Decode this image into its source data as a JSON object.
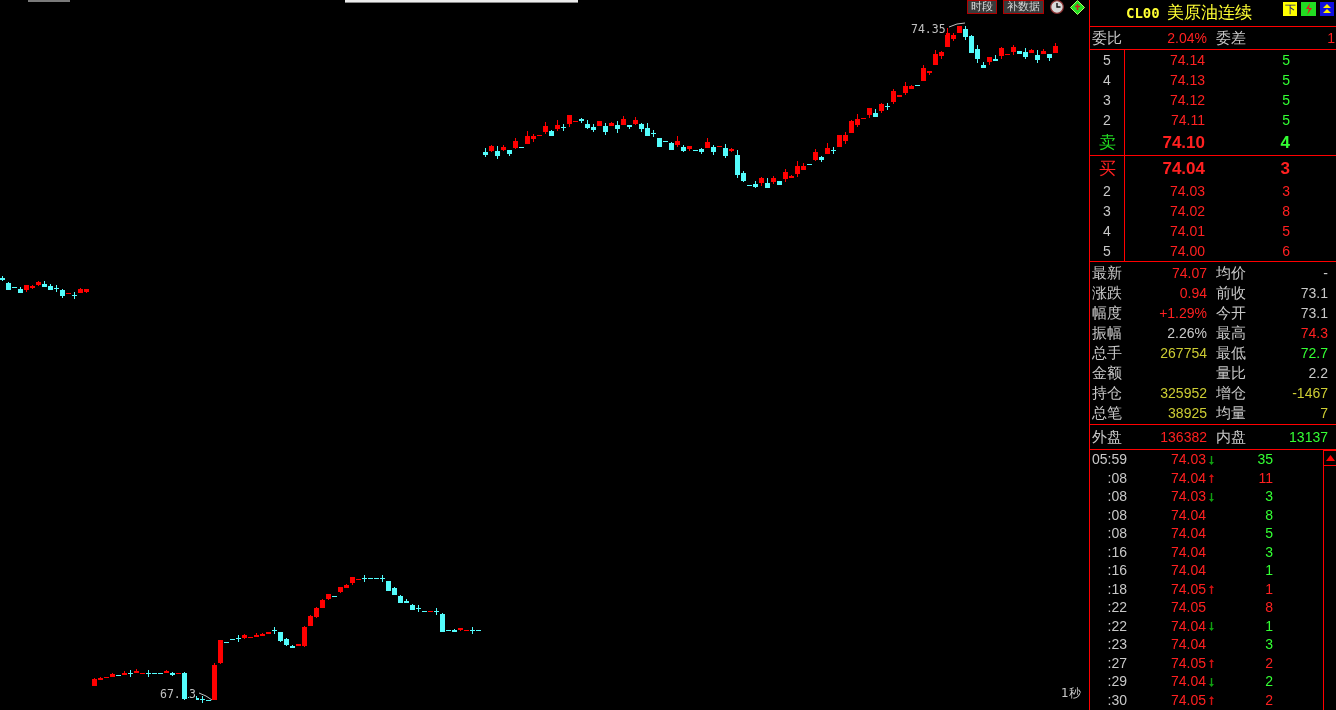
{
  "chart": {
    "toolbar": {
      "buttons": [
        {
          "label": "时段"
        },
        {
          "label": "补数据"
        }
      ]
    },
    "high_label": "74.35",
    "low_label_parts": [
      "67.",
      "3"
    ],
    "period": "1秒"
  },
  "quote_panel": {
    "symbol": "CL00",
    "name": "美原油连续",
    "header_buttons": [
      {
        "kind": "text",
        "label": "下"
      },
      {
        "kind": "lightning"
      },
      {
        "kind": "chevrons"
      }
    ],
    "order_ratio": {
      "label": "委比",
      "value": "2.04%",
      "diff_label": "委差",
      "diff_value": "1"
    },
    "asks": [
      {
        "level": "5",
        "price": "74.14",
        "volume": "5",
        "best": false
      },
      {
        "level": "4",
        "price": "74.13",
        "volume": "5",
        "best": false
      },
      {
        "level": "3",
        "price": "74.12",
        "volume": "5",
        "best": false
      },
      {
        "level": "2",
        "price": "74.11",
        "volume": "5",
        "best": false
      },
      {
        "level": "卖",
        "price": "74.10",
        "volume": "4",
        "best": true
      }
    ],
    "bids": [
      {
        "level": "买",
        "price": "74.04",
        "volume": "3",
        "best": true
      },
      {
        "level": "2",
        "price": "74.03",
        "volume": "3",
        "best": false
      },
      {
        "level": "3",
        "price": "74.02",
        "volume": "8",
        "best": false
      },
      {
        "level": "4",
        "price": "74.01",
        "volume": "5",
        "best": false
      },
      {
        "level": "5",
        "price": "74.00",
        "volume": "6",
        "best": false
      }
    ],
    "stats": [
      {
        "left": {
          "label": "最新",
          "value": "74.07",
          "color": "#ff2020"
        },
        "right": {
          "label": "均价",
          "value": "-",
          "color": "#c8c8c8"
        }
      },
      {
        "left": {
          "label": "涨跌",
          "value": "0.94",
          "color": "#ff2020"
        },
        "right": {
          "label": "前收",
          "value": "73.1",
          "color": "#c8c8c8"
        }
      },
      {
        "left": {
          "label": "幅度",
          "value": "+1.29%",
          "color": "#ff2020"
        },
        "right": {
          "label": "今开",
          "value": "73.1",
          "color": "#c8c8c8"
        }
      },
      {
        "left": {
          "label": "振幅",
          "value": "2.26%",
          "color": "#c8c8c8"
        },
        "right": {
          "label": "最高",
          "value": "74.3",
          "color": "#ff2020"
        }
      },
      {
        "left": {
          "label": "总手",
          "value": "267754",
          "color": "#cccc33"
        },
        "right": {
          "label": "最低",
          "value": "72.7",
          "color": "#33ff33"
        }
      },
      {
        "left": {
          "label": "金额"
        },
        "right": {
          "label": "量比",
          "value": "2.2",
          "color": "#c8c8c8"
        }
      },
      {
        "left": {
          "label": "持仓",
          "value": "325952",
          "color": "#cccc33"
        },
        "right": {
          "label": "增仓",
          "value": "-1467",
          "color": "#cccc33"
        }
      },
      {
        "left": {
          "label": "总笔",
          "value": "38925",
          "color": "#cccc33"
        },
        "right": {
          "label": "均量",
          "value": "7",
          "color": "#cccc33"
        }
      }
    ],
    "volume_split": [
      {
        "label": "外盘",
        "value": "136382",
        "color": "#ff2020"
      },
      {
        "label": "内盘",
        "value": "13137",
        "color": "#33ff33"
      }
    ],
    "ticks": [
      {
        "time": "05:59",
        "price": "74.03",
        "kind": "down",
        "volume": "35",
        "color": "#33ff33"
      },
      {
        "time": ":08",
        "price": "74.04",
        "kind": "up",
        "volume": "11",
        "color": "#ff2020"
      },
      {
        "time": ":08",
        "price": "74.03",
        "kind": "down",
        "volume": "3",
        "color": "#33ff33"
      },
      {
        "time": ":08",
        "price": "74.04",
        "kind": "flat",
        "volume": "8",
        "color": "#33ff33"
      },
      {
        "time": ":08",
        "price": "74.04",
        "kind": "flat",
        "volume": "5",
        "color": "#33ff33"
      },
      {
        "time": ":16",
        "price": "74.04",
        "kind": "flat",
        "volume": "3",
        "color": "#33ff33"
      },
      {
        "time": ":16",
        "price": "74.04",
        "kind": "flat",
        "volume": "1",
        "color": "#33ff33"
      },
      {
        "time": ":18",
        "price": "74.05",
        "kind": "up",
        "volume": "1",
        "color": "#ff2020"
      },
      {
        "time": ":22",
        "price": "74.05",
        "kind": "flat",
        "volume": "8",
        "color": "#ff2020"
      },
      {
        "time": ":22",
        "price": "74.04",
        "kind": "down",
        "volume": "1",
        "color": "#33ff33"
      },
      {
        "time": ":23",
        "price": "74.04",
        "kind": "flat",
        "volume": "3",
        "color": "#33ff33"
      },
      {
        "time": ":27",
        "price": "74.05",
        "kind": "up",
        "volume": "2",
        "color": "#ff2020"
      },
      {
        "time": ":29",
        "price": "74.04",
        "kind": "down",
        "volume": "2",
        "color": "#33ff33"
      },
      {
        "time": ":30",
        "price": "74.05",
        "kind": "up",
        "volume": "2",
        "color": "#ff2020"
      }
    ]
  }
}
